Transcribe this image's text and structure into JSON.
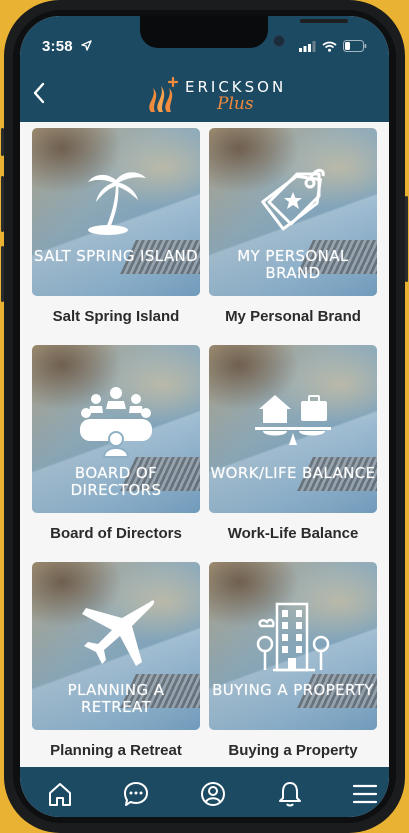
{
  "status": {
    "time": "3:58"
  },
  "header": {
    "brand_name": "ERICKSON",
    "brand_sub": "Plus"
  },
  "cards": [
    {
      "title": "Salt Spring Island",
      "overlay": "SALT SPRING ISLAND",
      "icon": "palm-tree-icon"
    },
    {
      "title": "My Personal Brand",
      "overlay": "MY PERSONAL BRAND",
      "icon": "price-tag-icon"
    },
    {
      "title": "Board of Directors",
      "overlay": "BOARD OF DIRECTORS",
      "icon": "meeting-table-icon"
    },
    {
      "title": "Work-Life Balance",
      "overlay": "WORK/LIFE BALANCE",
      "icon": "balance-scale-icon"
    },
    {
      "title": "Planning a Retreat",
      "overlay": "PLANNING A RETREAT",
      "icon": "airplane-icon"
    },
    {
      "title": "Buying a Property",
      "overlay": "BUYING A PROPERTY",
      "icon": "building-icon"
    }
  ],
  "tabbar": {
    "items": [
      "home-icon",
      "chat-icon",
      "profile-icon",
      "bell-icon",
      "menu-icon"
    ]
  },
  "colors": {
    "header": "#1d4a63",
    "background": "#e9b233",
    "accent": "#f08a3c"
  }
}
